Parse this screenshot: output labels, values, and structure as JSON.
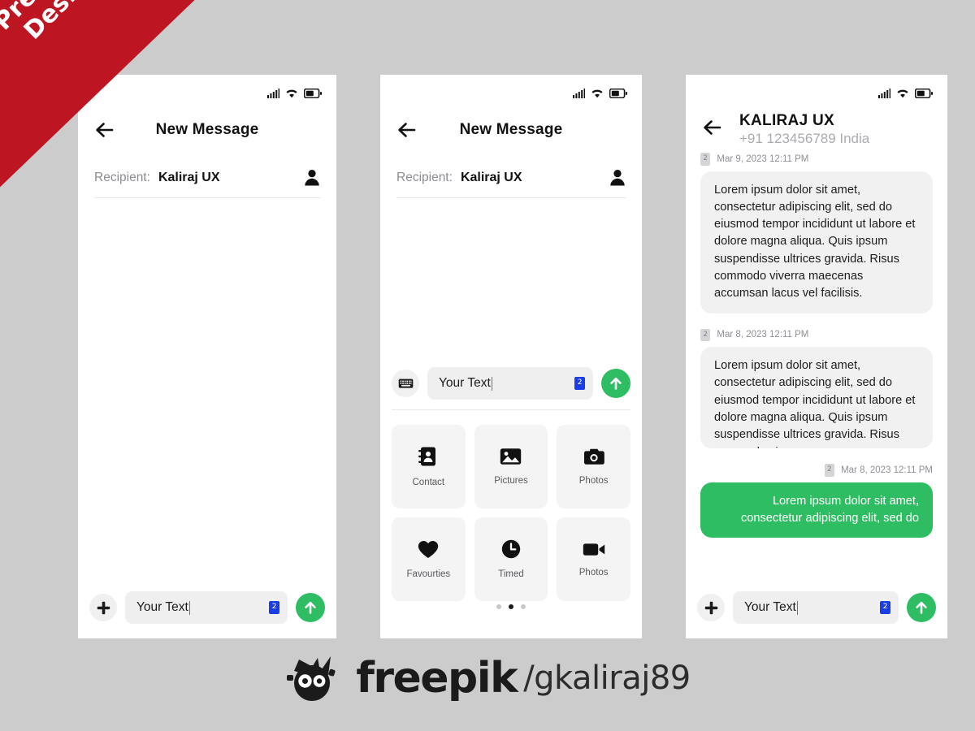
{
  "ribbon": {
    "line1": "Premium",
    "line2": "Design",
    "color": "#bd1622"
  },
  "theme": {
    "background": "#cccccc",
    "accent_green": "#2ebd62",
    "badge_blue": "#1a3de8",
    "bubble_in": "#f1f1f2"
  },
  "status_bar": {
    "signal": "signal-icon",
    "wifi": "wifi-icon",
    "battery": "battery-icon"
  },
  "phone1": {
    "title": "New Message",
    "back": "back-arrow",
    "recipient": {
      "label": "Recipient:",
      "value": "Kaliraj UX",
      "avatar_icon": "person-icon"
    },
    "composer": {
      "left_icon": "plus-icon",
      "text": "Your Text",
      "badge": "2",
      "send_icon": "arrow-up-icon"
    }
  },
  "phone2": {
    "title": "New Message",
    "back": "back-arrow",
    "recipient": {
      "label": "Recipient:",
      "value": "Kaliraj UX",
      "avatar_icon": "person-icon"
    },
    "composer": {
      "left_icon": "keyboard-icon",
      "text": "Your Text",
      "badge": "2",
      "send_icon": "arrow-up-icon"
    },
    "attachments": [
      {
        "label": "Contact",
        "icon": "contact-book-icon"
      },
      {
        "label": "Pictures",
        "icon": "image-icon"
      },
      {
        "label": "Photos",
        "icon": "camera-icon"
      },
      {
        "label": "Favourties",
        "icon": "heart-icon"
      },
      {
        "label": "Timed",
        "icon": "clock-icon"
      },
      {
        "label": "Photos",
        "icon": "video-camera-icon"
      }
    ],
    "pagination": {
      "count": 3,
      "active_index": 1
    }
  },
  "phone3": {
    "back": "back-arrow",
    "contact_name": "KALIRAJ UX",
    "contact_number": "+91 123456789 India",
    "messages": [
      {
        "direction": "in",
        "badge": "2",
        "timestamp": "Mar 9, 2023 12:11 PM",
        "text": "Lorem ipsum dolor sit amet, consectetur adipiscing elit, sed do eiusmod tempor incididunt ut labore et dolore magna aliqua. Quis ipsum suspendisse ultrices gravida. Risus commodo viverra maecenas accumsan lacus vel facilisis."
      },
      {
        "direction": "in",
        "badge": "2",
        "timestamp": "Mar 8, 2023 12:11 PM",
        "text": "Lorem ipsum dolor sit amet, consectetur adipiscing elit, sed do eiusmod tempor incididunt ut labore et dolore magna aliqua. Quis ipsum suspendisse ultrices gravida. Risus commodo viverra maecenas accumsan lacus vel"
      },
      {
        "direction": "out",
        "badge": "2",
        "timestamp": "Mar 8, 2023 12:11 PM",
        "text": "Lorem ipsum dolor sit amet, consectetur adipiscing elit, sed do"
      }
    ],
    "composer": {
      "left_icon": "plus-icon",
      "text": "Your Text",
      "badge": "2",
      "send_icon": "arrow-up-icon"
    }
  },
  "footer": {
    "brand": "freepik",
    "handle": "/gkaliraj89",
    "mark_icon": "freepik-crown-robot-icon"
  }
}
